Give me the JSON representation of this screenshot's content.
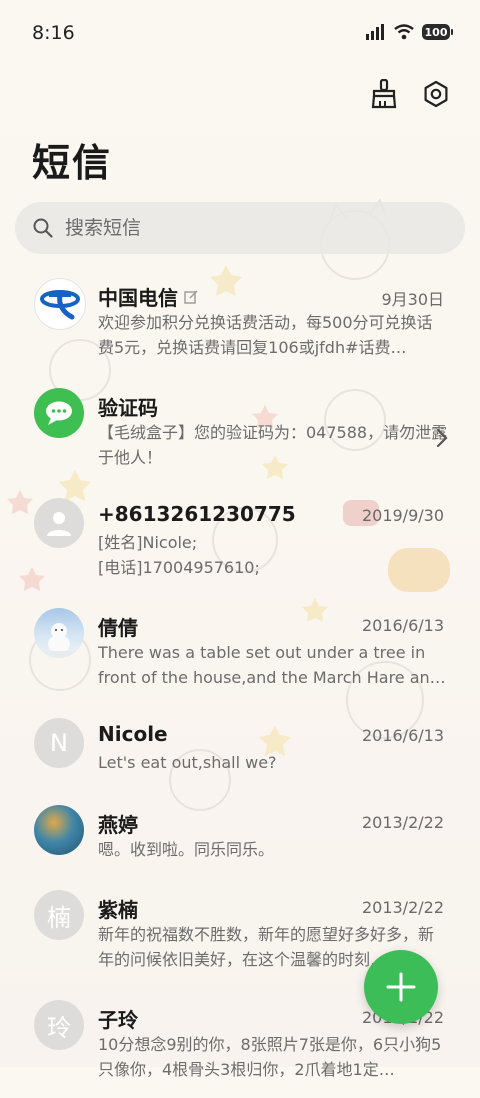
{
  "status_bar": {
    "time": "8:16",
    "battery": "100"
  },
  "header": {
    "title": "短信"
  },
  "search": {
    "placeholder": "搜索短信"
  },
  "colors": {
    "accent_green": "#3dbd58",
    "telecom_blue": "#1763c5"
  },
  "conversations": [
    {
      "name": "中国电信",
      "date": "9月30日",
      "preview": "欢迎参加积分兑换话费活动，每500分可兑换话费5元，兑换话费请回复106或jfdh#话费…",
      "avatar": "china-telecom-logo",
      "verified": true
    },
    {
      "name": "验证码",
      "date": "",
      "preview": "【毛绒盒子】您的验证码为：047588，请勿泄露于他人！",
      "avatar": "message-icon",
      "has_arrow": true
    },
    {
      "name": "+8613261230775",
      "date": "2019/9/30",
      "preview": "[姓名]Nicole;\n[电话]17004957610;",
      "avatar": "person-icon"
    },
    {
      "name": "倩倩",
      "date": "2016/6/13",
      "preview": "There was a table set out under a tree in front of the house,and the March Hare an…",
      "avatar": "photo-polar-bear"
    },
    {
      "name": "Nicole",
      "date": "2016/6/13",
      "preview": "Let's eat out,shall we?",
      "avatar_letter": "N"
    },
    {
      "name": "燕婷",
      "date": "2013/2/22",
      "preview": "嗯。收到啦。同乐同乐。",
      "avatar": "photo-landscape"
    },
    {
      "name": "紫楠",
      "date": "2013/2/22",
      "preview": "新年的祝福数不胜数，新年的愿望好多好多，新年的问候依旧美好，在这个温馨的时刻…",
      "avatar_letter": "楠"
    },
    {
      "name": "子玲",
      "date": "2013/2/22",
      "preview": "10分想念9别的你，8张照片7张是你，6只小狗5只像你，4根骨头3根归你，2爪着地1定…",
      "avatar_letter": "玲"
    }
  ]
}
